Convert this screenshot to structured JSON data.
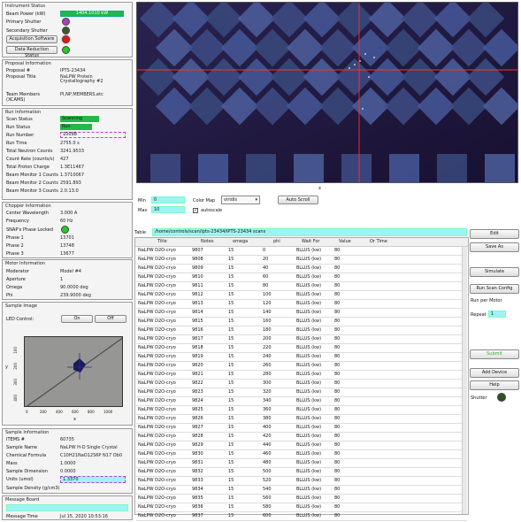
{
  "instrument_status": {
    "title": "Instrument Status",
    "beam_power_label": "Beam Power (kW)",
    "beam_power_value": "1404.1010 kW",
    "primary_shutter_label": "Primary Shutter",
    "secondary_shutter_label": "Secondary Shutter",
    "acquisition_button": "Acquisition Software",
    "data_reduction_button": "Data Reduction Status",
    "colors": {
      "primary": "#b03cb8",
      "secondary": "#3a5a2a",
      "acq": "#e01818",
      "red": "#22cc22"
    }
  },
  "proposal": {
    "title": "Proposal Information",
    "labels": [
      "Proposal #",
      "Proposal Title",
      "Team Members\n(XCAMS)"
    ],
    "values": [
      "IPTS-23434",
      "NaLPW Protein\nCrystallography #2",
      "PI,NP,MEMBERS,etc"
    ]
  },
  "run": {
    "title": "Run Information",
    "labels": [
      "Scan Status",
      "Run Status",
      "Run Number",
      "Run Time",
      "Total Neutron Counts",
      "Count Rate (counts/s)",
      "Total Proton Charge",
      "Beam Monitor 1 Counts",
      "Beam Monitor 2 Counts",
      "Beam Monitor 3 Counts"
    ],
    "values": [
      "Scanning",
      "Run",
      "10098",
      "2755.0 s",
      "3241.9533",
      "427",
      "1.3E11467",
      "1.3710067",
      "2591.893",
      "2.0.13.0"
    ],
    "scan_status_color": "#22b84a",
    "run_status_color": "#22b84a"
  },
  "chopper": {
    "title": "Chopper Information",
    "labels": [
      "Center Wavelength",
      "Frequency",
      "SNAP's Phase Locked",
      "Phase 1",
      "Phase 2",
      "Phase 3"
    ],
    "values": [
      "3.000 A",
      "60 Hz",
      "",
      "13701",
      "13748",
      "13677"
    ]
  },
  "motor": {
    "title": "Motor Information",
    "labels": [
      "Moderator",
      "Aperture",
      "Omega",
      "Phi"
    ],
    "values": [
      "Model #4",
      "1",
      "90.0000 deg",
      "239.9000 deg"
    ]
  },
  "sample_image": {
    "title": "Sample Image",
    "led_label": "LED Control:",
    "on_label": "On",
    "off_label": "Off",
    "y_ticks": [
      "100",
      "200",
      "300",
      "400"
    ],
    "x_ticks": [
      "0",
      "200",
      "400",
      "600",
      "800",
      "1000"
    ],
    "x_axis_label": "x",
    "y_axis_label": "y"
  },
  "sample_info": {
    "title": "Sample Information",
    "labels": [
      "ITEMS #",
      "Sample Name",
      "Chemical Formula",
      "Mass",
      "Sample Dimension",
      "Units (umol)",
      "Sample Density (g/cm3)"
    ],
    "values": [
      "60735",
      "NaLPW H-D Single Crystal",
      "C10H21NaO12S6P N17 Ob0",
      "1.0000",
      "0.0000",
      "1.3370",
      ""
    ]
  },
  "message_board": {
    "title": "Message Board",
    "message": "",
    "label": "Message Time",
    "value": "Jul 15, 2020 10:53:16"
  },
  "detector_view": {
    "x_axis_label": "x",
    "min_label": "Min",
    "max_label": "Max",
    "min_value": "0",
    "max_value": "10",
    "color_map_label": "Color Map",
    "color_map_value": "viridis",
    "autoscale_label": "autoscale",
    "auto_scroll_button": "Auto Scroll"
  },
  "table": {
    "table_label": "Table",
    "path": "/home/controls/scan/ipts-23434/IPTS-23434 scans",
    "columns": [
      "Title",
      "Notes",
      "omega",
      "phi",
      "Wait For",
      "Value",
      "Or Time"
    ],
    "rows": [
      [
        "NaLPW D2O-cryo",
        "9807",
        "15",
        "0",
        "BLLUS (kw)",
        "80",
        ""
      ],
      [
        "NaLPW D2O-cryo",
        "9808",
        "15",
        "20",
        "BLLUS (kw)",
        "80",
        ""
      ],
      [
        "NaLPW D2O-cryo",
        "9809",
        "15",
        "40",
        "BLLUS (kw)",
        "80",
        ""
      ],
      [
        "NaLPW D2O-cryo",
        "9810",
        "15",
        "60",
        "BLLUS (kw)",
        "80",
        ""
      ],
      [
        "NaLPW D2O-cryo",
        "9811",
        "15",
        "80",
        "BLLUS (kw)",
        "80",
        ""
      ],
      [
        "NaLPW D2O-cryo",
        "9812",
        "15",
        "100",
        "BLLUS (kw)",
        "80",
        ""
      ],
      [
        "NaLPW D2O-cryo",
        "9813",
        "15",
        "120",
        "BLLUS (kw)",
        "80",
        ""
      ],
      [
        "NaLPW D2O-cryo",
        "9814",
        "15",
        "140",
        "BLLUS (kw)",
        "80",
        ""
      ],
      [
        "NaLPW D2O-cryo",
        "9815",
        "15",
        "160",
        "BLLUS (kw)",
        "80",
        ""
      ],
      [
        "NaLPW D2O-cryo",
        "9816",
        "15",
        "180",
        "BLLUS (kw)",
        "80",
        ""
      ],
      [
        "NaLPW D2O-cryo",
        "9817",
        "15",
        "200",
        "BLLUS (kw)",
        "80",
        ""
      ],
      [
        "NaLPW D2O-cryo",
        "9818",
        "15",
        "220",
        "BLLUS (kw)",
        "80",
        ""
      ],
      [
        "NaLPW D2O-cryo",
        "9819",
        "15",
        "240",
        "BLLUS (kw)",
        "80",
        ""
      ],
      [
        "NaLPW D2O-cryo",
        "9820",
        "15",
        "260",
        "BLLUS (kw)",
        "80",
        ""
      ],
      [
        "NaLPW D2O-cryo",
        "9821",
        "15",
        "280",
        "BLLUS (kw)",
        "80",
        ""
      ],
      [
        "NaLPW D2O-cryo",
        "9822",
        "15",
        "300",
        "BLLUS (kw)",
        "80",
        ""
      ],
      [
        "NaLPW D2O-cryo",
        "9823",
        "15",
        "320",
        "BLLUS (kw)",
        "80",
        ""
      ],
      [
        "NaLPW D2O-cryo",
        "9824",
        "15",
        "340",
        "BLLUS (kw)",
        "80",
        ""
      ],
      [
        "NaLPW D2O-cryo",
        "9825",
        "15",
        "360",
        "BLLUS (kw)",
        "80",
        ""
      ],
      [
        "NaLPW D2O-cryo",
        "9826",
        "15",
        "380",
        "BLLUS (kw)",
        "80",
        ""
      ],
      [
        "NaLPW D2O-cryo",
        "9827",
        "15",
        "400",
        "BLLUS (kw)",
        "80",
        ""
      ],
      [
        "NaLPW D2O-cryo",
        "9828",
        "15",
        "420",
        "BLLUS (kw)",
        "80",
        ""
      ],
      [
        "NaLPW D2O-cryo",
        "9829",
        "15",
        "440",
        "BLLUS (kw)",
        "80",
        ""
      ],
      [
        "NaLPW D2O-cryo",
        "9830",
        "15",
        "460",
        "BLLUS (kw)",
        "80",
        ""
      ],
      [
        "NaLPW D2O-cryo",
        "9831",
        "15",
        "480",
        "BLLUS (kw)",
        "80",
        ""
      ],
      [
        "NaLPW D2O-cryo",
        "9832",
        "15",
        "500",
        "BLLUS (kw)",
        "80",
        ""
      ],
      [
        "NaLPW D2O-cryo",
        "9833",
        "15",
        "520",
        "BLLUS (kw)",
        "80",
        ""
      ],
      [
        "NaLPW D2O-cryo",
        "9834",
        "15",
        "540",
        "BLLUS (kw)",
        "80",
        ""
      ],
      [
        "NaLPW D2O-cryo",
        "9835",
        "15",
        "560",
        "BLLUS (kw)",
        "80",
        ""
      ],
      [
        "NaLPW D2O-cryo",
        "9836",
        "15",
        "580",
        "BLLUS (kw)",
        "80",
        ""
      ],
      [
        "NaLPW D2O-cryo",
        "9837",
        "15",
        "600",
        "BLLUS (kw)",
        "80",
        ""
      ]
    ]
  },
  "side_buttons": {
    "edit": "Edit",
    "save_as": "Save As",
    "simulate": "Simulate",
    "run_scan_config": "Run Scan Config",
    "run_per_motor": "Run per Motor",
    "repeat_label": "Repeat",
    "repeat_value": "1",
    "submit": "Submit",
    "add_device": "Add Device",
    "help": "Help",
    "shutter_label": "Shutter"
  }
}
